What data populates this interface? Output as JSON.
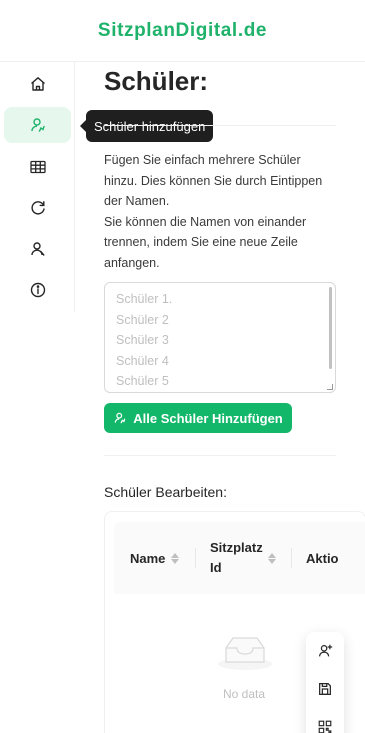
{
  "brand": {
    "name": "SitzplanDigital.de",
    "color": "#1fb26b"
  },
  "sidebar": {
    "items": [
      {
        "icon": "home-icon",
        "label": "home"
      },
      {
        "icon": "user-add-icon",
        "label": "Schüler hinzufügen",
        "active": true
      },
      {
        "icon": "table-icon"
      },
      {
        "icon": "refresh-icon"
      },
      {
        "icon": "users-icon"
      },
      {
        "icon": "info-icon"
      }
    ]
  },
  "tooltip": {
    "text": "Schüler hinzufügen"
  },
  "page": {
    "title": "Schüler:",
    "description": [
      "Fügen Sie einfach mehrere Schüler hinzu. Dies können Sie durch Eintippen der Namen.",
      "Sie können die Namen von einander trennen, indem Sie eine neue Zeile anfangen."
    ],
    "textarea_placeholder_lines": [
      "Schüler 1.",
      "Schüler 2",
      "Schüler 3",
      "Schüler 4",
      "Schüler 5"
    ],
    "add_button_label": "Alle Schüler Hinzufügen",
    "edit_section_title": "Schüler Bearbeiten:"
  },
  "table": {
    "columns": [
      "Name",
      "Sitzplatz Id",
      "Aktio"
    ],
    "empty_text": "No data"
  },
  "floating_actions": [
    {
      "icon": "user-plus-icon"
    },
    {
      "icon": "save-icon"
    },
    {
      "icon": "qr-code-icon"
    }
  ],
  "colors": {
    "primary": "#12b76a",
    "active_bg": "#e6f7ee"
  }
}
